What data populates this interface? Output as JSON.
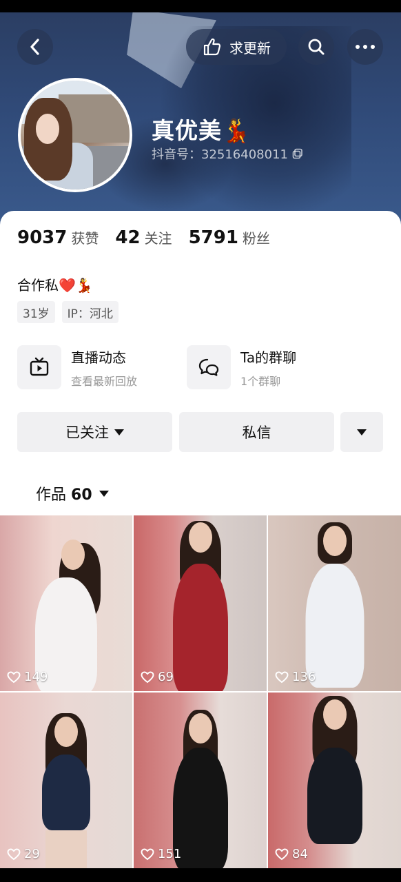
{
  "header": {
    "back_icon": "chevron-left-icon",
    "request_update_label": "求更新",
    "request_update_icon": "hand-point-icon",
    "search_icon": "search-icon",
    "more_icon": "more-dots-icon"
  },
  "profile": {
    "name": "真优美💃",
    "douyin_id": "抖音号：32516408011",
    "stats": [
      {
        "num": "9037",
        "label": "获赞"
      },
      {
        "num": "42",
        "label": "关注"
      },
      {
        "num": "5791",
        "label": "粉丝"
      }
    ],
    "bio": "合作私❤️💃",
    "tags": [
      "31岁",
      "IP：河北"
    ]
  },
  "features": [
    {
      "title": "直播动态",
      "sub": "查看最新回放",
      "icon": "tv-play-icon"
    },
    {
      "title": "Ta的群聊",
      "sub": "1个群聊",
      "icon": "chat-bubbles-icon"
    }
  ],
  "actions": {
    "follow_label": "已关注",
    "message_label": "私信"
  },
  "works_tab": {
    "label": "作品",
    "count": "60"
  },
  "videos": [
    {
      "likes": "149"
    },
    {
      "likes": "69"
    },
    {
      "likes": "136"
    },
    {
      "likes": "29"
    },
    {
      "likes": "151"
    },
    {
      "likes": "84"
    }
  ],
  "colors": {
    "banner": "#304a78",
    "accent_heart": "#e0303a"
  }
}
